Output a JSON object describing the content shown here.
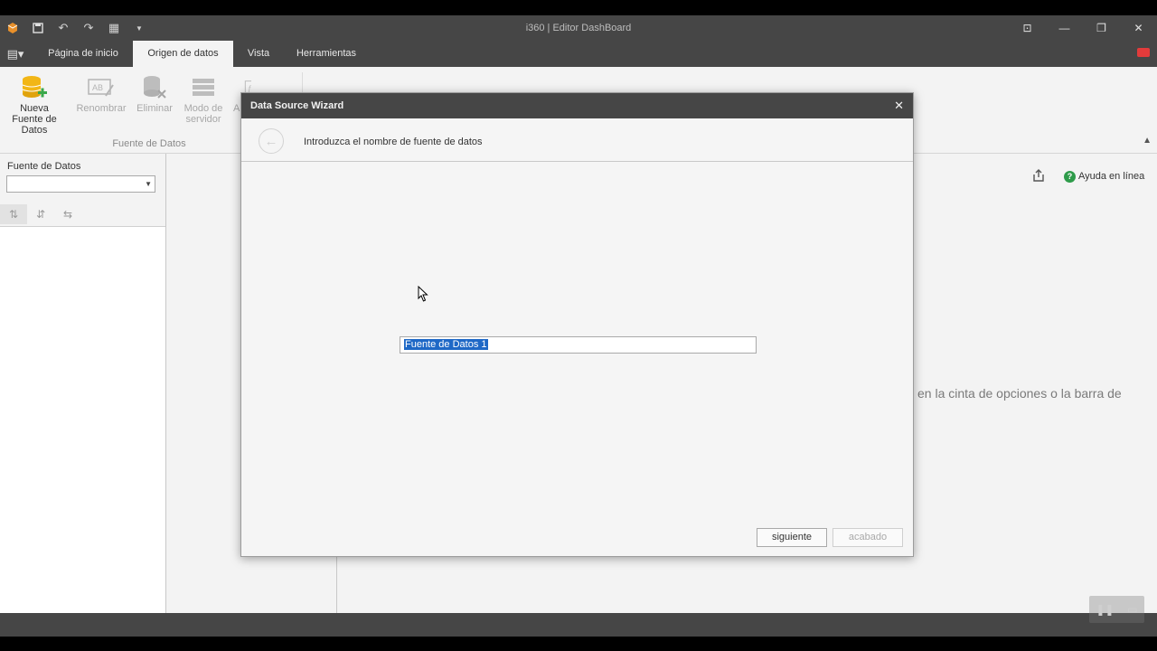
{
  "window": {
    "title": "i360 | Editor DashBoard"
  },
  "tabs": [
    {
      "label": "Página de inicio",
      "active": false
    },
    {
      "label": "Origen de datos",
      "active": true
    },
    {
      "label": "Vista",
      "active": false
    },
    {
      "label": "Herramientas",
      "active": false
    }
  ],
  "ribbon": {
    "buttons": [
      {
        "label": "Nueva Fuente de Datos",
        "icon": "database-add-icon",
        "enabled": true
      },
      {
        "label": "Renombrar",
        "icon": "rename-icon",
        "enabled": false
      },
      {
        "label": "Eliminar",
        "icon": "database-delete-icon",
        "enabled": false
      },
      {
        "label": "Modo de servidor",
        "icon": "server-mode-icon",
        "enabled": false
      },
      {
        "label": "A",
        "icon": "function-icon",
        "enabled": false
      }
    ],
    "group_label": "Fuente de Datos"
  },
  "left_panel": {
    "label": "Fuente de Datos",
    "combo_value": ""
  },
  "main": {
    "help_label": "Ayuda en línea",
    "hint_text": "en la cinta de opciones o la barra de"
  },
  "dialog": {
    "title": "Data Source Wizard",
    "prompt": "Introduzca el nombre de fuente de datos",
    "name_value": "Fuente de Datos 1",
    "next_label": "siguiente",
    "finish_label": "acabado"
  },
  "colors": {
    "chrome_dark": "#464646",
    "selection": "#1e68c6",
    "help_green": "#2e9b4a",
    "database_yellow": "#f2b616",
    "add_green": "#3aa84a"
  }
}
